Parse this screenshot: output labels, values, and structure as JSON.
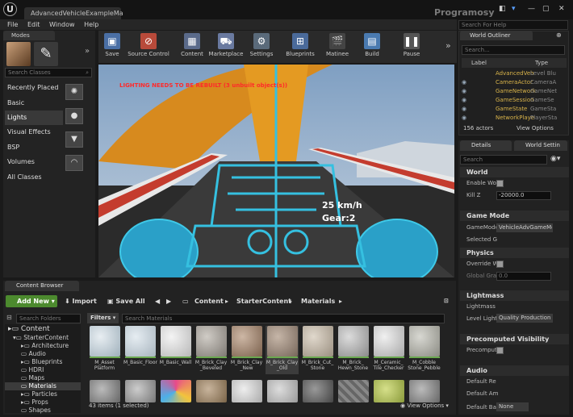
{
  "window": {
    "tab_title": "AdvancedVehicleExampleMa",
    "brand": "Programosy"
  },
  "menu": [
    "File",
    "Edit",
    "Window",
    "Help"
  ],
  "help_search": {
    "placeholder": "Search For Help"
  },
  "modes": {
    "tab": "Modes",
    "search_placeholder": "Search Classes",
    "categories": [
      "Recently Placed",
      "Basic",
      "Lights",
      "Visual Effects",
      "BSP",
      "Volumes",
      "All Classes"
    ],
    "selected": "Lights"
  },
  "toolbar": {
    "items": [
      "Save",
      "Source Control",
      "Content",
      "Marketplace",
      "Settings",
      "Blueprints",
      "Matinee",
      "Build",
      "Pause"
    ]
  },
  "viewport": {
    "warning": "LIGHTING NEEDS TO BE REBUILT (3 unbuilt object(s))",
    "speed": "25 km/h",
    "gear": "Gear:2"
  },
  "outliner": {
    "tab": "World Outliner",
    "search_placeholder": "Search...",
    "col_label": "Label",
    "col_type": "Type",
    "rows": [
      {
        "label": "AdvancedVeh",
        "type": "Level Blu"
      },
      {
        "label": "CameraActor",
        "type": "CameraA"
      },
      {
        "label": "GameNetwork",
        "type": "GameNet"
      },
      {
        "label": "GameSession",
        "type": "GameSe"
      },
      {
        "label": "GameState",
        "type": "GameSta"
      },
      {
        "label": "NetworkPlaye",
        "type": "PlayerSta"
      }
    ],
    "count": "156 actors",
    "view_options": "View Options"
  },
  "details": {
    "tab_details": "Details",
    "tab_world": "World Settin",
    "search_placeholder": "Search",
    "sections": {
      "world": "World",
      "game_mode": "Game Mode",
      "physics": "Physics",
      "lightmass": "Lightmass",
      "precomputed": "Precomputed Visibility",
      "audio": "Audio"
    },
    "props": {
      "enable_world": "Enable Wor",
      "kill_z": "Kill Z",
      "kill_z_val": "-20000.0",
      "game_mode": "GameMode",
      "game_mode_val": "VehicleAdvGameMo",
      "selected": "Selected G",
      "override": "Override W",
      "global_grav": "Global Grav",
      "global_grav_val": "0.0",
      "lightmass": "Lightmass",
      "lightmass_q": "Level Light",
      "quality": "Quality Production",
      "precomputed": "Precomput",
      "default_re": "Default Re",
      "default_am": "Default Am",
      "default_ba": "Default Ba",
      "none": "None"
    }
  },
  "content_browser": {
    "tab": "Content Browser",
    "add_new": "Add New",
    "import": "Import",
    "save_all": "Save All",
    "crumbs": [
      "Content",
      "StarterContent",
      "Materials"
    ],
    "search_folders": "Search Folders",
    "filters": "Filters",
    "search_materials": "Search Materials",
    "tree": [
      "Content",
      "StarterContent",
      "Architecture",
      "Audio",
      "Blueprints",
      "HDRI",
      "Maps",
      "Materials",
      "Particles",
      "Props",
      "Shapes"
    ],
    "tiles": [
      {
        "name": "M_Asset Platform"
      },
      {
        "name": "M_Basic_Floor"
      },
      {
        "name": "M_Basic_Wall"
      },
      {
        "name": "M_Brick_Clay _Beveled"
      },
      {
        "name": "M_Brick_Clay _New"
      },
      {
        "name": "M_Brick_Clay _Old"
      },
      {
        "name": "M_Brick_Cut_ Stone"
      },
      {
        "name": "M_Brick_ Hewn_Stone"
      },
      {
        "name": "M_Ceramic_ Tile_Checker"
      },
      {
        "name": "M_Cobble Stone_Pebble"
      }
    ],
    "status": "43 items (1 selected)",
    "view_options": "View Options"
  },
  "colors": {
    "accent_green": "#4c8a2e",
    "outliner_label": "#d8b34a",
    "warning_red": "#ff2a2a"
  }
}
